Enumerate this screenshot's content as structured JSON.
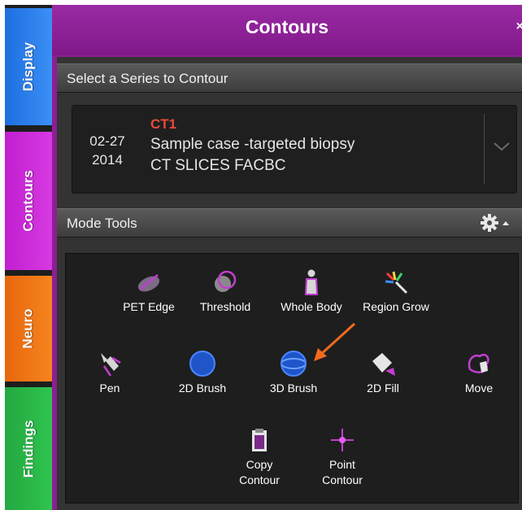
{
  "tabs": [
    {
      "label": "Display",
      "color": "#2a80ea"
    },
    {
      "label": "Contours",
      "color": "#cc2ad9"
    },
    {
      "label": "Neuro",
      "color": "#f07817"
    },
    {
      "label": "Findings",
      "color": "#28b747"
    }
  ],
  "panel": {
    "title": "Contours",
    "close_glyph": "×",
    "header_color": "#8b1f93"
  },
  "series_section": {
    "header": "Select a Series to Contour",
    "selected": {
      "date_month_day": "02-27",
      "date_year": "2014",
      "id": "CT1",
      "description": "Sample case -targeted biopsy",
      "series_name": "CT SLICES FACBC"
    },
    "dropdown_icon": "chevron-down-icon"
  },
  "mode_tools": {
    "header": "Mode Tools",
    "settings_icon": "gear-icon",
    "tools": [
      {
        "label": "PET Edge",
        "icon": "pet-edge-icon"
      },
      {
        "label": "Threshold",
        "icon": "threshold-icon"
      },
      {
        "label": "Whole Body",
        "icon": "whole-body-icon"
      },
      {
        "label": "Region Grow",
        "icon": "region-grow-icon"
      },
      {
        "label": "Pen",
        "icon": "pen-icon"
      },
      {
        "label": "2D Brush",
        "icon": "2d-brush-icon"
      },
      {
        "label": "3D Brush",
        "icon": "3d-brush-icon"
      },
      {
        "label": "2D Fill",
        "icon": "2d-fill-icon"
      },
      {
        "label": "Move",
        "icon": "move-icon"
      },
      {
        "label_line1": "Copy",
        "label_line2": "Contour",
        "icon": "copy-contour-icon"
      },
      {
        "label_line1": "Point",
        "label_line2": "Contour",
        "icon": "point-contour-icon"
      }
    ],
    "highlight_color": "#f26a1e"
  }
}
